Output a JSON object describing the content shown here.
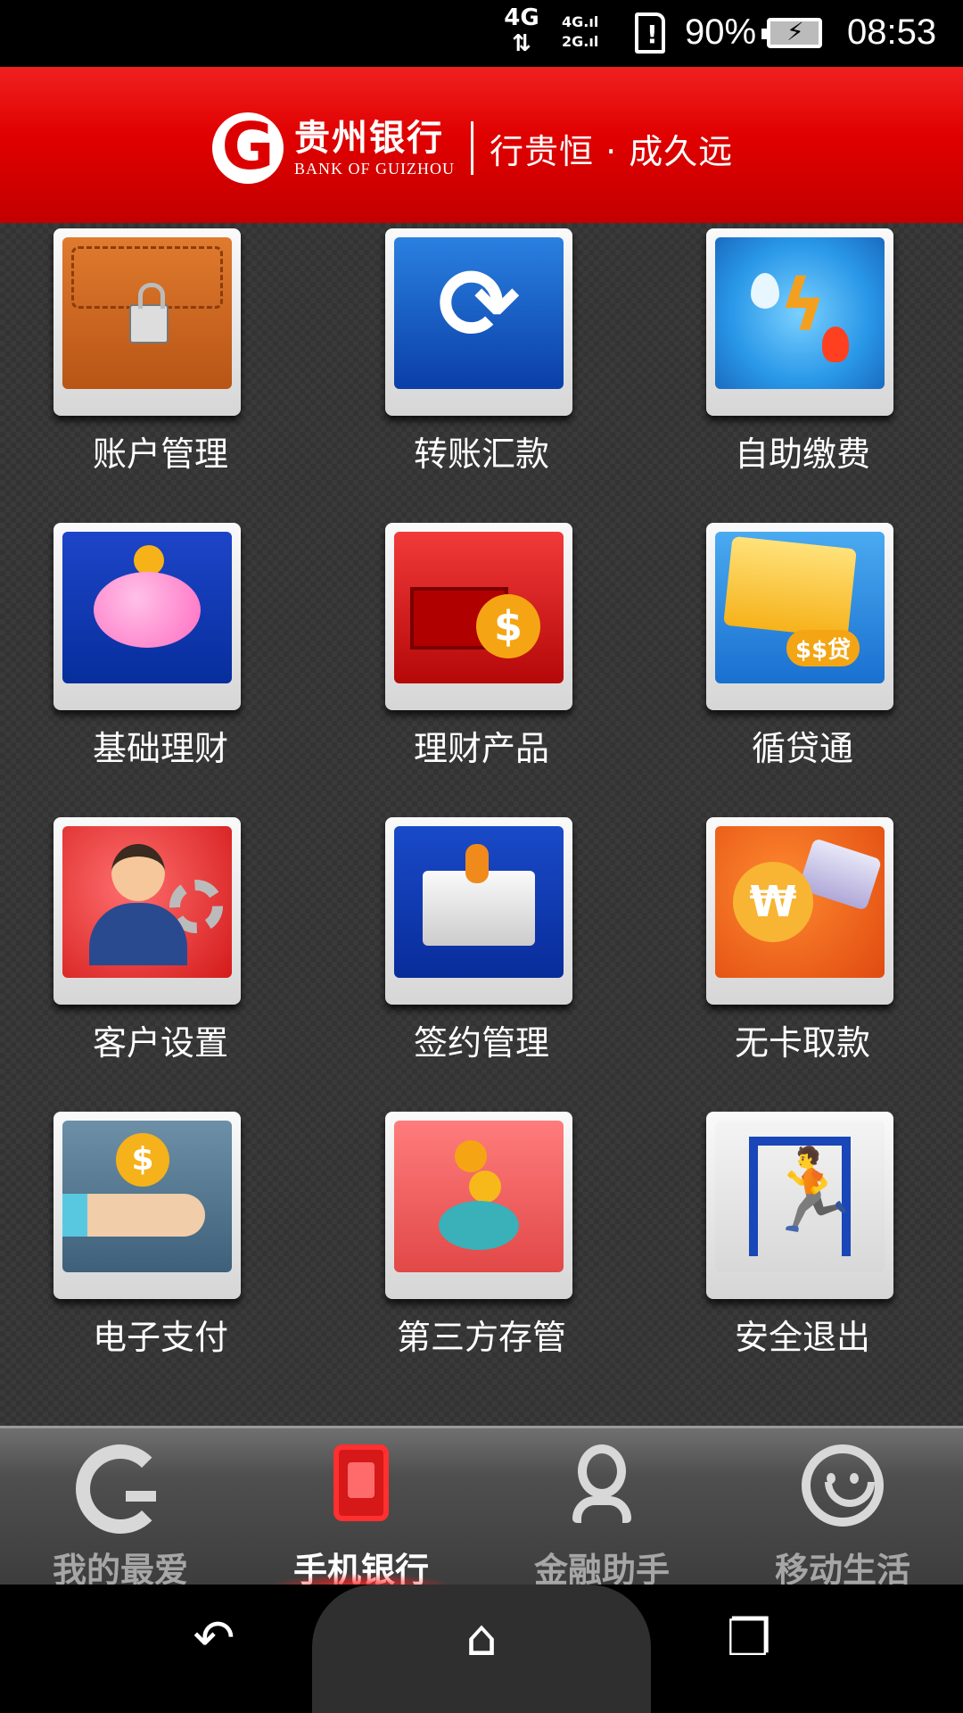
{
  "status_bar": {
    "network": "4G",
    "signal": "4G 2G",
    "battery_percent": "90%",
    "time": "08:53"
  },
  "header": {
    "logo_letter": "G",
    "bank_name_cn": "贵州银行",
    "bank_name_en": "BANK OF GUIZHOU",
    "slogan": "行贵恒 · 成久远",
    "brand_color": "#e00000"
  },
  "menu": [
    {
      "label": "账户管理",
      "icon": "briefcase-lock-icon"
    },
    {
      "label": "转账汇款",
      "icon": "refresh-arrows-icon"
    },
    {
      "label": "自助缴费",
      "icon": "water-electric-icon"
    },
    {
      "label": "基础理财",
      "icon": "piggy-bank-icon"
    },
    {
      "label": "理财产品",
      "icon": "basket-dollar-icon"
    },
    {
      "label": "循贷通",
      "icon": "credit-card-loan-icon"
    },
    {
      "label": "客户设置",
      "icon": "user-gear-icon"
    },
    {
      "label": "签约管理",
      "icon": "folder-stamp-icon"
    },
    {
      "label": "无卡取款",
      "icon": "money-bag-card-icon"
    },
    {
      "label": "电子支付",
      "icon": "hand-coin-icon"
    },
    {
      "label": "第三方存管",
      "icon": "piggy-coins-icon"
    },
    {
      "label": "安全退出",
      "icon": "exit-door-icon"
    }
  ],
  "bottom_nav": {
    "items": [
      {
        "label": "我的最爱",
        "icon": "favorites-g-icon",
        "active": false
      },
      {
        "label": "手机银行",
        "icon": "mobile-bank-icon",
        "active": true
      },
      {
        "label": "金融助手",
        "icon": "assistant-person-icon",
        "active": false
      },
      {
        "label": "移动生活",
        "icon": "smile-face-icon",
        "active": false
      }
    ]
  },
  "system_nav": {
    "back": "back-icon",
    "home": "home-icon",
    "recents": "recents-icon"
  }
}
